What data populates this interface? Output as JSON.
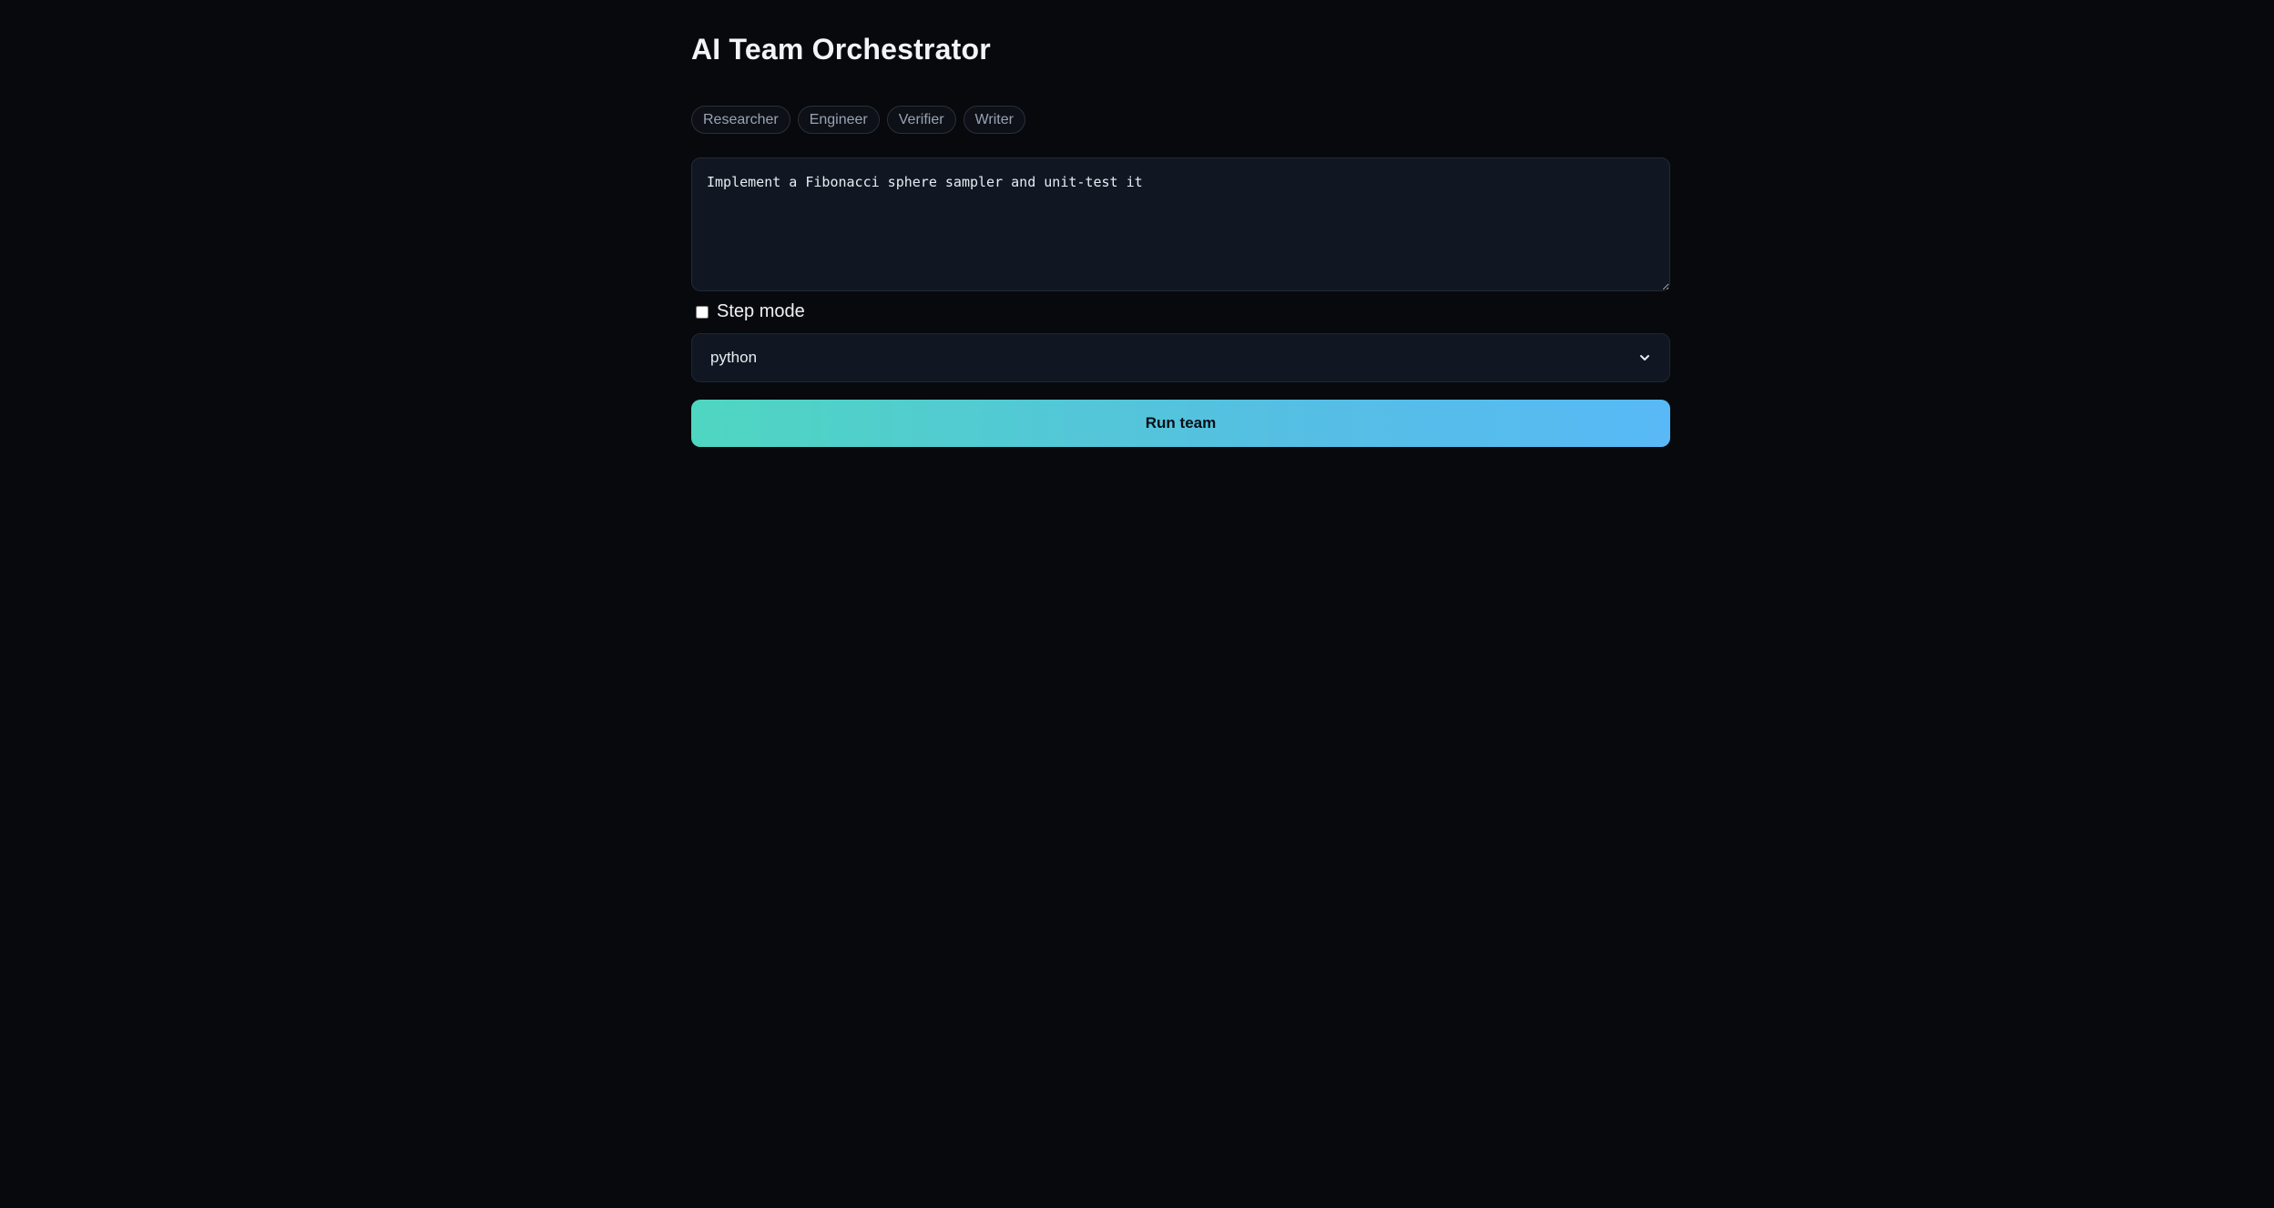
{
  "header": {
    "title": "AI Team Orchestrator"
  },
  "agents": [
    {
      "label": "Researcher"
    },
    {
      "label": "Engineer"
    },
    {
      "label": "Verifier"
    },
    {
      "label": "Writer"
    }
  ],
  "task": {
    "value": "Implement a Fibonacci sphere sampler and unit-test it"
  },
  "step_mode": {
    "label": "Step mode",
    "checked": false
  },
  "language": {
    "selected": "python",
    "icon": "chevron-down-icon"
  },
  "run": {
    "label": "Run team",
    "gradient": [
      "#4fd6c1",
      "#58b9f6"
    ]
  },
  "colors": {
    "background": "#07090d",
    "panel": "#111722"
  }
}
